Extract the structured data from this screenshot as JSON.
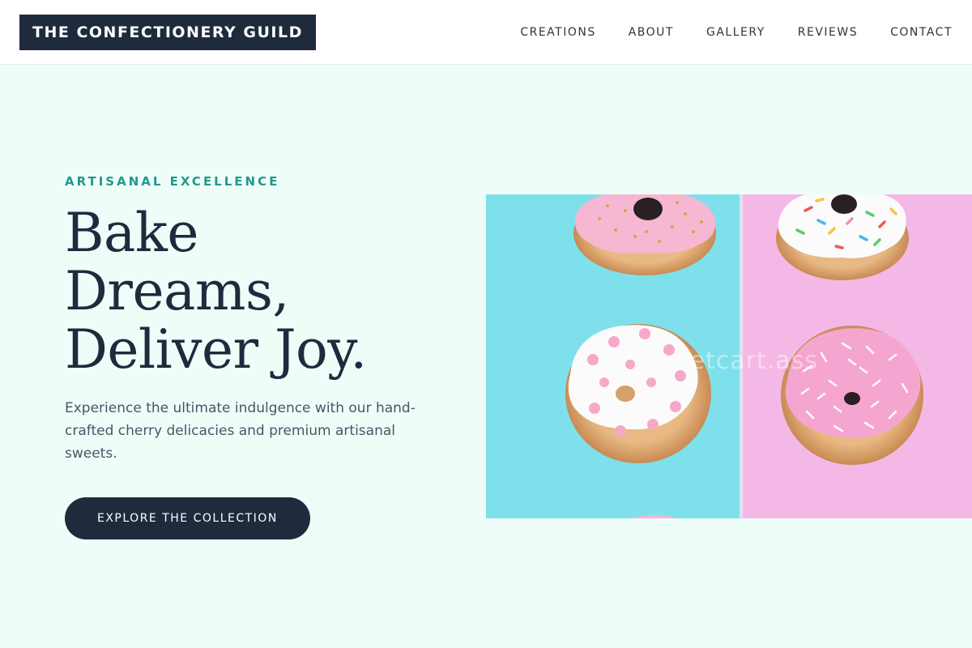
{
  "header": {
    "brand": "THE CONFECTIONERY GUILD",
    "nav": [
      "CREATIONS",
      "ABOUT",
      "GALLERY",
      "REVIEWS",
      "CONTACT"
    ]
  },
  "hero": {
    "kicker": "ARTISANAL EXCELLENCE",
    "headline_lines": [
      "Bake",
      "Dreams,",
      "Deliver Joy."
    ],
    "subtext": "Experience the ultimate indulgence with our hand-crafted cherry delicacies and premium artisanal sweets.",
    "cta_label": "EXPLORE THE COLLECTION",
    "image": {
      "watermark": "sweetcart.ass",
      "left_background": "#7ee0ea",
      "right_background": "#f4b8e6"
    }
  },
  "colors": {
    "page_background": "#effdf9",
    "primary": "#1f2a3d",
    "accent": "#1f9a8c"
  }
}
